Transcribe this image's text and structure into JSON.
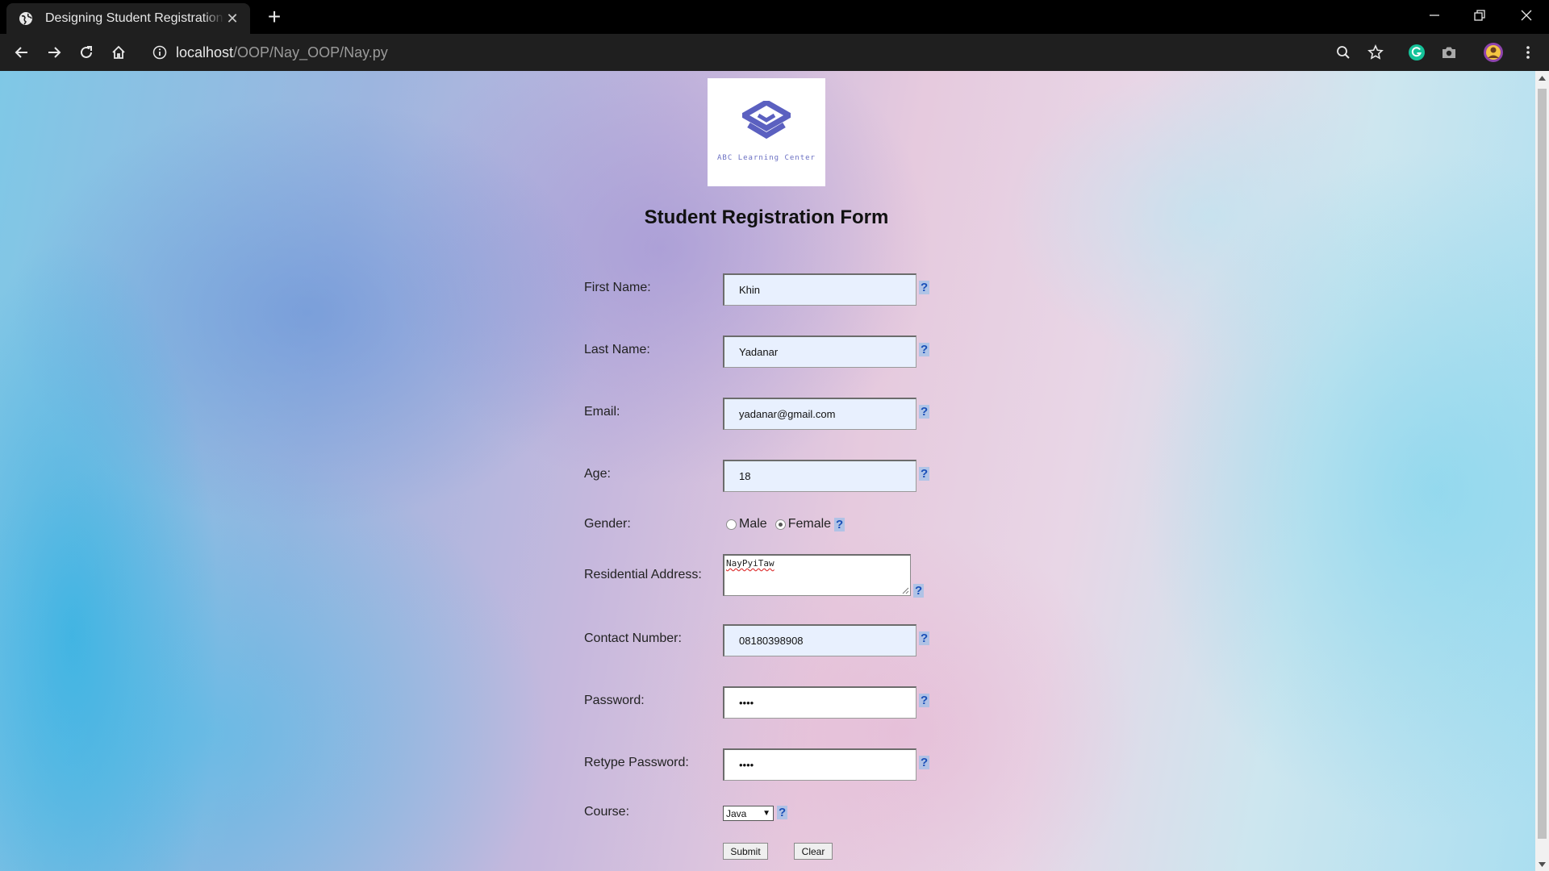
{
  "browser": {
    "tab_title": "Designing Student Registration Form",
    "new_tab_symbol": "+",
    "close_tab_symbol": "✕",
    "url_host": "localhost",
    "url_path": "/OOP/Nay_OOP/Nay.py"
  },
  "logo": {
    "text": "ABC Learning Center",
    "color": "#5b60c0"
  },
  "form": {
    "title": "Student Registration Form",
    "help_symbol": "?",
    "first_name": {
      "label": "First Name:",
      "value": "Khin"
    },
    "last_name": {
      "label": "Last Name:",
      "value": "Yadanar"
    },
    "email": {
      "label": "Email:",
      "value": "yadanar@gmail.com"
    },
    "age": {
      "label": "Age:",
      "value": "18"
    },
    "gender": {
      "label": "Gender:",
      "options": [
        "Male",
        "Female"
      ],
      "selected": "Female"
    },
    "address": {
      "label": "Residential Address:",
      "value": "NayPyiTaw"
    },
    "contact": {
      "label": "Contact Number:",
      "value": "08180398908"
    },
    "password": {
      "label": "Password:",
      "value": "••••"
    },
    "retype_password": {
      "label": "Retype Password:",
      "value": "••••"
    },
    "course": {
      "label": "Course:",
      "value": "Java"
    },
    "submit_label": "Submit",
    "clear_label": "Clear"
  }
}
